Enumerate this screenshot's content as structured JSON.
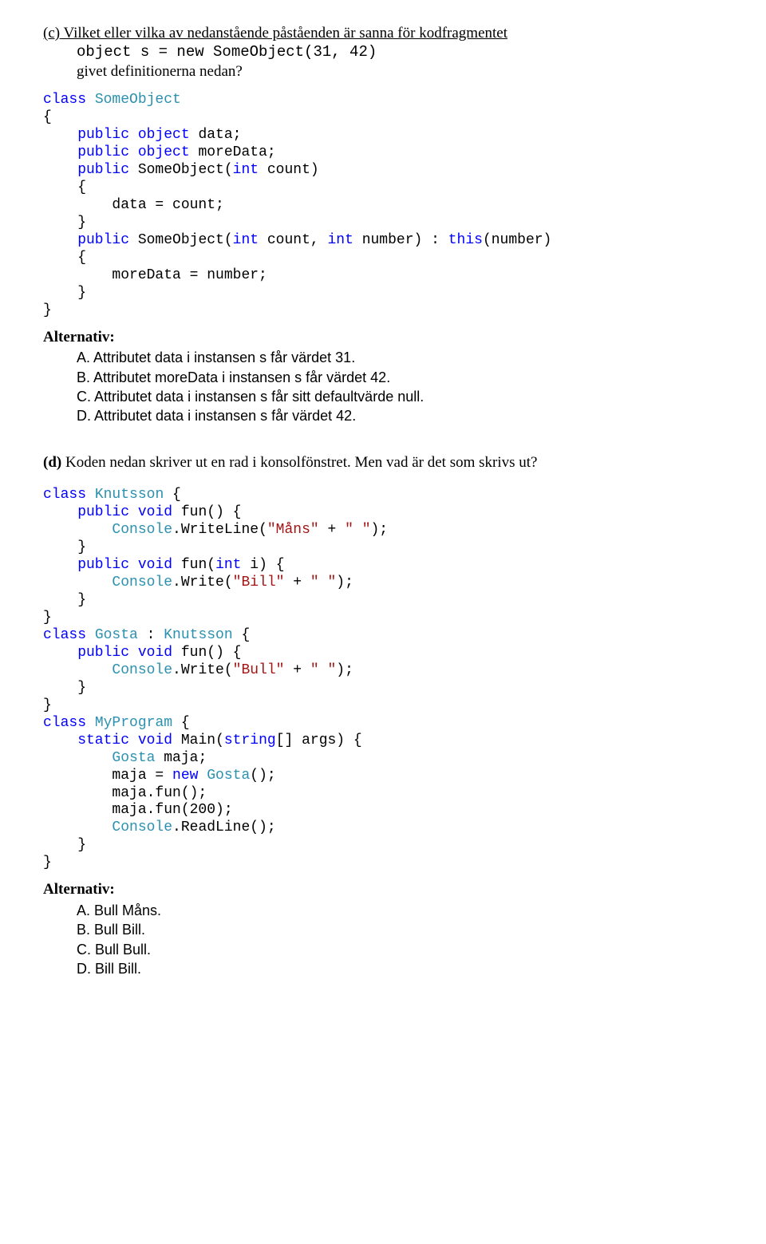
{
  "qc": {
    "label": "(c)",
    "intro_underlined": "Vilket eller vilka av nedanstående påståenden är sanna för kodfragmentet",
    "code_line": "object s = new SomeObject(31, 42)",
    "given_line": "givet definitionerna nedan?",
    "code": {
      "l1a": "class",
      "l1b": " SomeObject",
      "l2": "{",
      "l3a": "    public",
      "l3b": " object",
      "l3c": " data;",
      "l4a": "    public",
      "l4b": " object",
      "l4c": " moreData;",
      "l5a": "    public",
      "l5b": " SomeObject(",
      "l5c": "int",
      "l5d": " count)",
      "l6": "    {",
      "l7": "        data = count;",
      "l8": "    }",
      "l9a": "    public",
      "l9b": " SomeObject(",
      "l9c": "int",
      "l9d": " count, ",
      "l9e": "int",
      "l9f": " number) : ",
      "l9g": "this",
      "l9h": "(number)",
      "l10": "    {",
      "l11": "        moreData = number;",
      "l12": "    }",
      "l13": "}"
    },
    "alt_heading": "Alternativ:",
    "alts": {
      "A": "A. Attributet data i instansen s får värdet 31.",
      "B": "B. Attributet moreData i instansen s får värdet 42.",
      "C": "C. Attributet data i instansen s får sitt defaultvärde null.",
      "D": "D. Attributet data i instansen s får värdet 42."
    }
  },
  "qd": {
    "label": "(d)",
    "intro": " Koden nedan skriver ut en rad i konsolfönstret. Men vad är det som skrivs ut?",
    "code": {
      "l1a": "class",
      "l1b": " ",
      "l1c": "Knutsson",
      "l1d": " {",
      "l2a": "    public",
      "l2b": " ",
      "l2c": "void",
      "l2d": " fun() {",
      "l3a": "        ",
      "l3b": "Console",
      "l3c": ".WriteLine(",
      "l3d": "\"Måns\"",
      "l3e": " + ",
      "l3f": "\" \"",
      "l3g": ");",
      "l4": "    }",
      "l5a": "    public",
      "l5b": " ",
      "l5c": "void",
      "l5d": " fun(",
      "l5e": "int",
      "l5f": " i) {",
      "l6a": "        ",
      "l6b": "Console",
      "l6c": ".Write(",
      "l6d": "\"Bill\"",
      "l6e": " + ",
      "l6f": "\" \"",
      "l6g": ");",
      "l7": "    }",
      "l8": "}",
      "l9a": "class",
      "l9b": " ",
      "l9c": "Gosta",
      "l9d": " : ",
      "l9e": "Knutsson",
      "l9f": " {",
      "l10a": "    public",
      "l10b": " ",
      "l10c": "void",
      "l10d": " fun() {",
      "l11a": "        ",
      "l11b": "Console",
      "l11c": ".Write(",
      "l11d": "\"Bull\"",
      "l11e": " + ",
      "l11f": "\" \"",
      "l11g": ");",
      "l12": "    }",
      "l13": "}",
      "l14a": "class",
      "l14b": " ",
      "l14c": "MyProgram",
      "l14d": " {",
      "l15a": "    static",
      "l15b": " ",
      "l15c": "void",
      "l15d": " Main(",
      "l15e": "string",
      "l15f": "[] args) {",
      "l16a": "        ",
      "l16b": "Gosta",
      "l16c": " maja;",
      "l17a": "        maja = ",
      "l17b": "new",
      "l17c": " ",
      "l17d": "Gosta",
      "l17e": "();",
      "l18": "        maja.fun();",
      "l19": "        maja.fun(200);",
      "l20a": "        ",
      "l20b": "Console",
      "l20c": ".ReadLine();",
      "l21": "    }",
      "l22": "}"
    },
    "alt_heading": "Alternativ:",
    "alts": {
      "A": "A. Bull Måns.",
      "B": "B. Bull Bill.",
      "C": "C. Bull Bull.",
      "D": "D. Bill Bill."
    }
  }
}
